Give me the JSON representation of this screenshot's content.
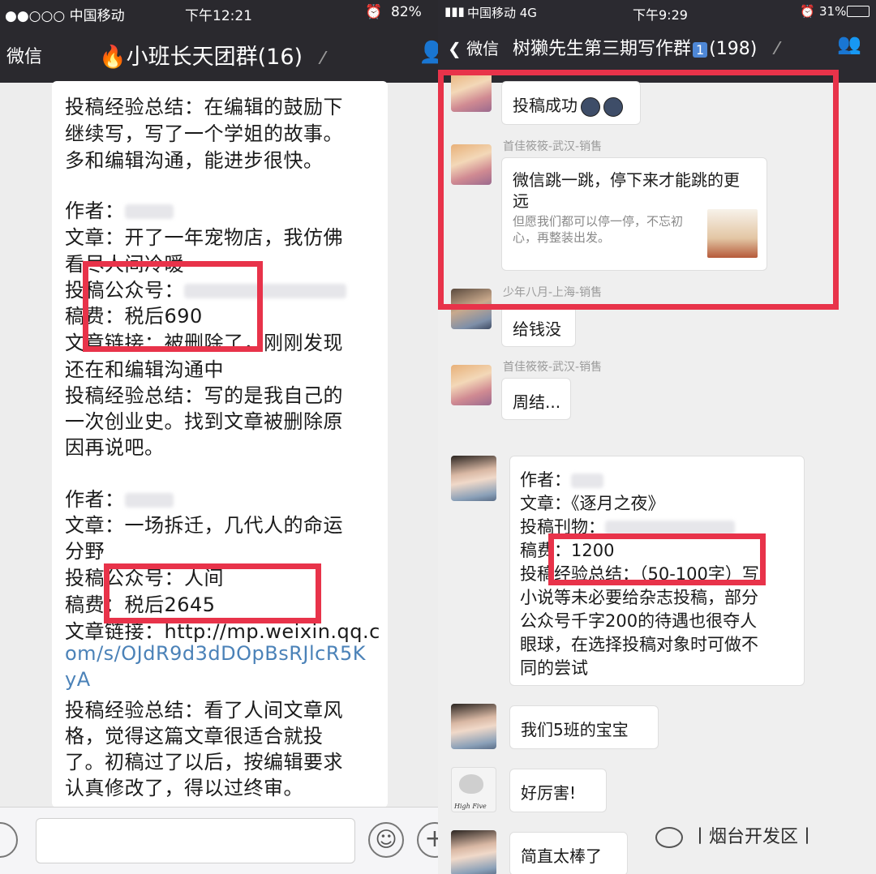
{
  "left": {
    "status": {
      "carrier": "●●○○○ 中国移动",
      "time": "下午12:21",
      "battery": "82%"
    },
    "nav": {
      "back": "微信",
      "title": "小班长天团群(16)"
    },
    "lines": [
      "投稿经验总结：在编辑的鼓励下",
      "继续写，写了一个学姐的故事。",
      "多和编辑沟通，能进步很快。",
      "作者：",
      "文章：开了一年宠物店，我仿佛",
      "看尽人间冷暖",
      "投稿公众号：",
      "稿费：税后690",
      "文章链接：被删除了，刚刚发现",
      "还在和编辑沟通中",
      "投稿经验总结：写的是我自己的",
      "一次创业史。找到文章被删除原",
      "因再说吧。",
      "作者：",
      "文章：一场拆迁，几代人的命运",
      "分野",
      "投稿公众号：人间",
      "稿费：税后2645",
      "文章链接：http://mp.weixin.qq.c",
      "om/s/OJdR9d3dDOpBsRJlcR5K",
      "yA",
      "投稿经验总结：看了人间文章风",
      "格，觉得这篇文章很适合就投",
      "了。初稿过了以后，按编辑要求",
      "认真修改了，得以过终审。"
    ]
  },
  "right": {
    "status": {
      "carrier": "中国移动  4G",
      "time": "下午9:29",
      "battery": "31%"
    },
    "nav": {
      "back": "微信",
      "title": "树獭先生第三期写作群",
      "badge": "1",
      "count": "(198)"
    },
    "messages": {
      "m1": "投稿成功",
      "m2_sender": "首佳筱筱-武汉-销售",
      "m2_title_1": "微信跳一跳，停下来才能跳的更",
      "m2_title_2": "远",
      "m2_desc_1": "但愿我们都可以停一停，不忘初",
      "m2_desc_2": "心，再整装出发。",
      "m3_sender": "少年八月-上海-销售",
      "m3": "给钱没",
      "m4_sender": "首佳筱筱-武汉-销售",
      "m4": "周结...",
      "m5_lines": [
        "作者：",
        "文章：《逐月之夜》",
        "投稿刊物：",
        "稿费：1200",
        "投稿经验总结：（50-100字）写",
        "小说等未必要给杂志投稿，部分",
        "公众号千字200的待遇也很夺人",
        "眼球，在选择投稿对象时可做不",
        "同的尝试"
      ],
      "m6": "我们5班的宝宝",
      "m7": "好厉害!",
      "m8": "简直太棒了",
      "cat_caption": "High Five"
    }
  },
  "watermark": "丨烟台开发区丨",
  "colors": {
    "highlight": "#e8334a",
    "navbar": "#2a292e",
    "link": "#4b82b8"
  }
}
